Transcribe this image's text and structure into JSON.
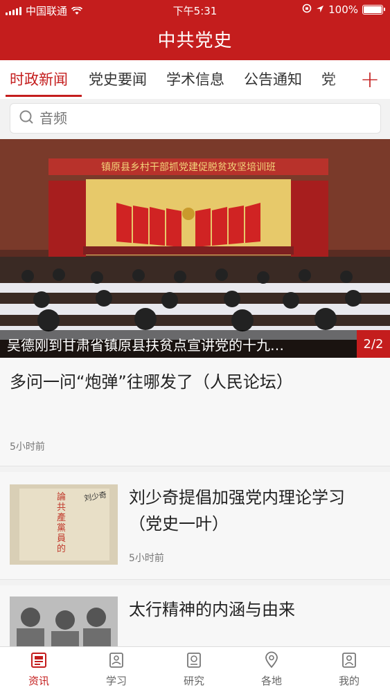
{
  "status_bar": {
    "carrier": "中国联通",
    "time": "下午5:31",
    "battery": "100%",
    "battery_level": 1.0
  },
  "header": {
    "title": "中共党史"
  },
  "tabs": [
    {
      "label": "时政新闻",
      "active": true
    },
    {
      "label": "党史要闻"
    },
    {
      "label": "学术信息"
    },
    {
      "label": "公告通知"
    },
    {
      "label": "党"
    }
  ],
  "add_tab_icon": "plus-icon",
  "search": {
    "placeholder": "音频",
    "icon": "search-icon"
  },
  "banner": {
    "stage_sign": "镇原县乡村干部抓党建促脱贫攻坚培训班",
    "caption": "吴德刚到甘肃省镇原县扶贫点宣讲党的十九…",
    "page_indicator": "2/2"
  },
  "feed": [
    {
      "title": "多问一问“炮弹”往哪发了（人民论坛）",
      "time": "5小时前",
      "has_thumb": false
    },
    {
      "title_line1": "刘少奇提倡加强党内理论学习",
      "title_line2": "（党史一叶）",
      "time": "5小时前",
      "has_thumb": true,
      "thumb_text": "論共產黨員的修養",
      "thumb_sign": "刘少奇"
    },
    {
      "title": "太行精神的内涵与由来",
      "has_thumb": true
    }
  ],
  "bottom_nav": [
    {
      "label": "资讯",
      "icon": "news-icon",
      "active": true
    },
    {
      "label": "学习",
      "icon": "study-icon"
    },
    {
      "label": "研究",
      "icon": "research-icon"
    },
    {
      "label": "各地",
      "icon": "location-icon"
    },
    {
      "label": "我的",
      "icon": "profile-icon"
    }
  ],
  "colors": {
    "brand_red": "#c41d1d",
    "background": "#f2f2f2"
  }
}
